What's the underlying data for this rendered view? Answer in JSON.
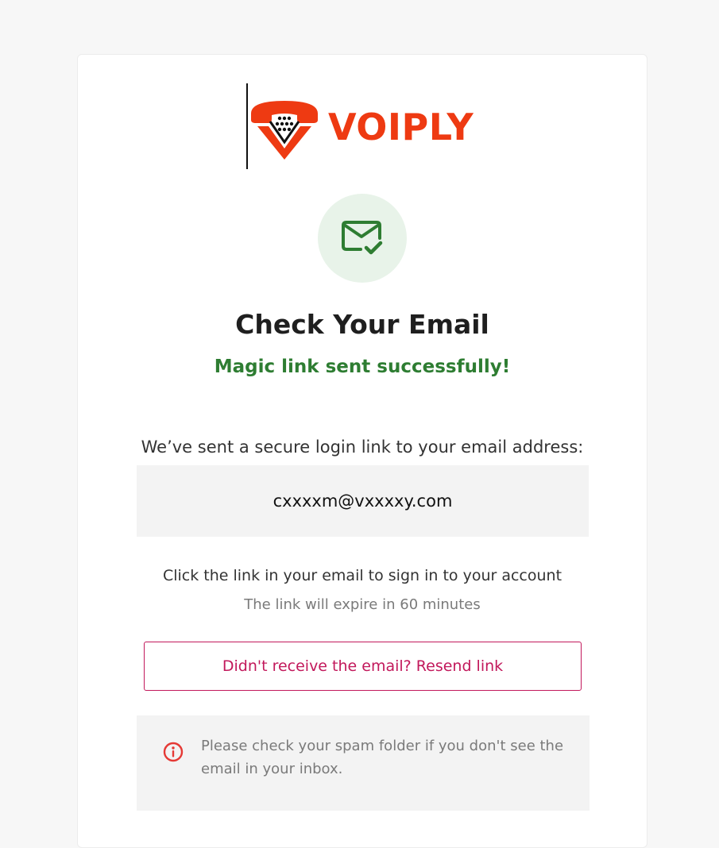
{
  "brand": {
    "name": "VOIPLY",
    "color": "#ee3a12",
    "logo_icon": "telephone-v-icon"
  },
  "status_icon": {
    "name": "mail-check-icon",
    "color": "#2e7d32",
    "background": "#e8f3e9"
  },
  "title": "Check Your Email",
  "subtitle": "Magic link sent successfully!",
  "sent_text": "We’ve sent a secure login link to your email address:",
  "email": "cxxxxm@vxxxxy.com",
  "instruction": "Click the link in your email to sign in to your account",
  "expiry": "The link will expire in 60 minutes",
  "resend_button": {
    "label": "Didn't receive the email? Resend link",
    "color": "#c2185b"
  },
  "notice": {
    "icon": "info-icon",
    "icon_color": "#e53935",
    "text": "Please check your spam folder if you don't see the email in your inbox."
  }
}
